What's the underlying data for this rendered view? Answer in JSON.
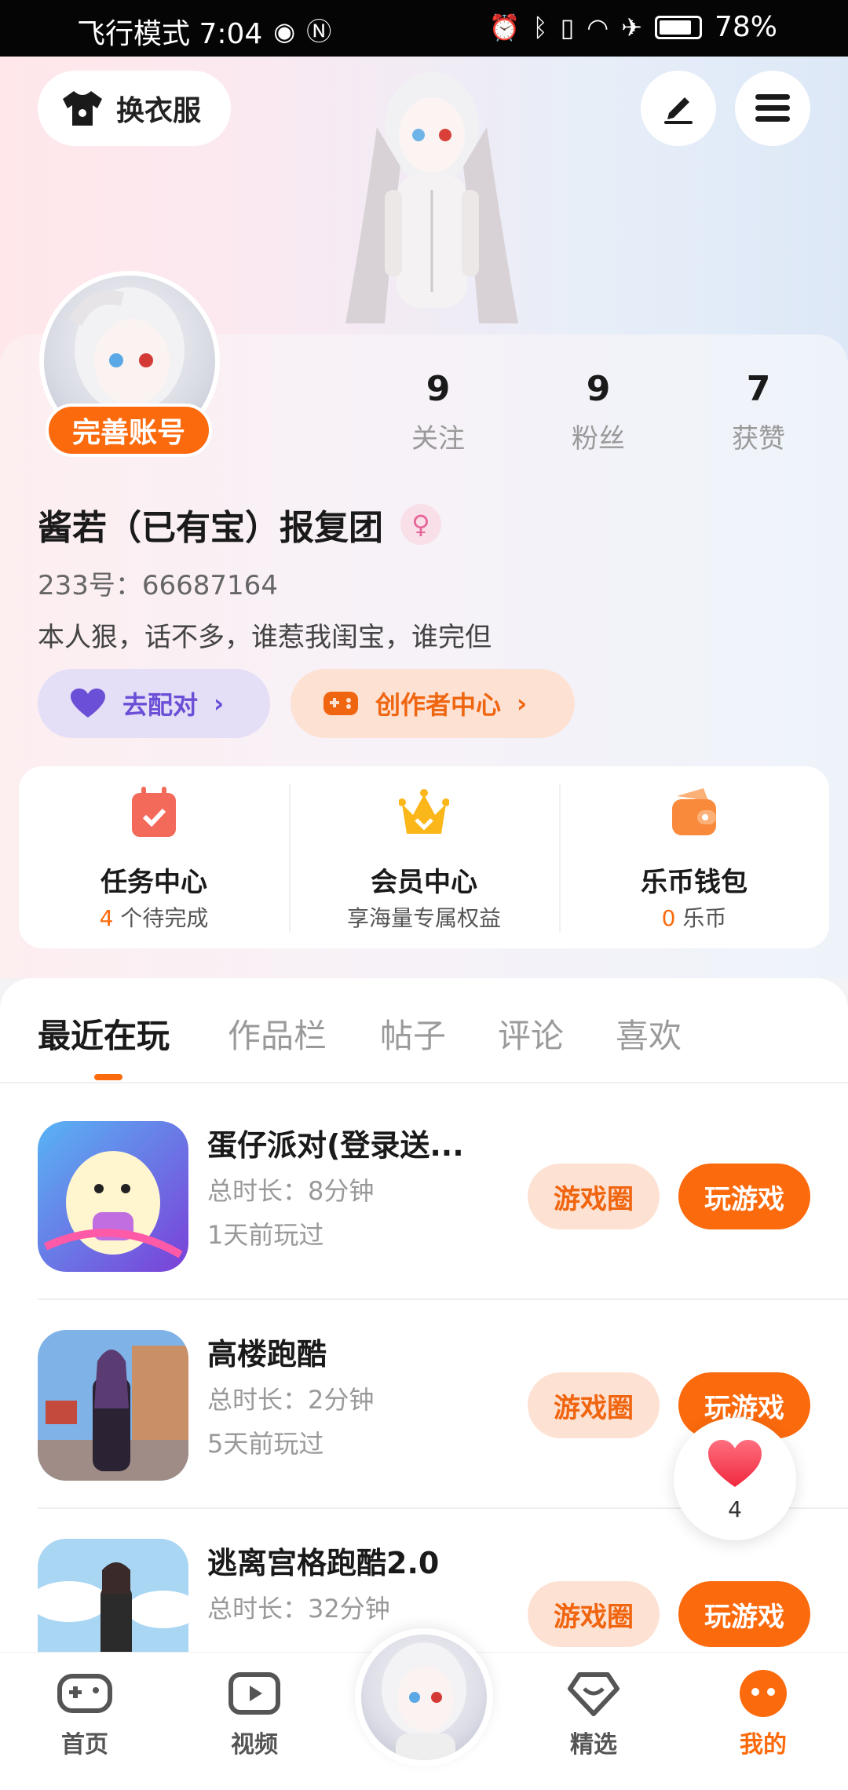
{
  "status_bar": {
    "left_text": "飞行模式 7:04",
    "battery_percent": "78%"
  },
  "header": {
    "outfit_label": "换衣服",
    "icons": [
      "shirt-icon",
      "edit-icon",
      "menu-icon"
    ]
  },
  "profile": {
    "complete_label": "完善账号",
    "stats": [
      {
        "value": "9",
        "label": "关注"
      },
      {
        "value": "9",
        "label": "粉丝"
      },
      {
        "value": "7",
        "label": "获赞"
      }
    ],
    "username": "酱若（已有宝）报复团",
    "gender": "female",
    "uid": "233号：66687164",
    "bio": "本人狠，话不多，谁惹我闺宝，谁完但",
    "match_label": "去配对",
    "creator_label": "创作者中心"
  },
  "quick": [
    {
      "title": "任务中心",
      "sub_highlight": "4",
      "sub_text": " 个待完成",
      "icon": "task-calendar-icon"
    },
    {
      "title": "会员中心",
      "sub_highlight": "",
      "sub_text": "享海量专属权益",
      "icon": "crown-icon"
    },
    {
      "title": "乐币钱包",
      "sub_highlight": "0",
      "sub_text": " 乐币",
      "icon": "wallet-icon"
    }
  ],
  "tabs": [
    {
      "label": "最近在玩",
      "active": true
    },
    {
      "label": "作品栏",
      "active": false
    },
    {
      "label": "帖子",
      "active": false
    },
    {
      "label": "评论",
      "active": false
    },
    {
      "label": "喜欢",
      "active": false
    }
  ],
  "games": [
    {
      "title": "蛋仔派对(登录送...",
      "duration": "总时长：8分钟",
      "last_played": "1天前玩过"
    },
    {
      "title": "高楼跑酷",
      "duration": "总时长：2分钟",
      "last_played": "5天前玩过"
    },
    {
      "title": "逃离宫格跑酷2.0",
      "duration": "总时长：32分钟",
      "last_played": ""
    }
  ],
  "game_actions": {
    "circle_label": "游戏圈",
    "play_label": "玩游戏"
  },
  "float_like_count": "4",
  "nav": [
    {
      "label": "首页",
      "icon": "gamepad-icon",
      "active": false
    },
    {
      "label": "视频",
      "icon": "video-icon",
      "active": false
    },
    {
      "label": "精选",
      "icon": "heart-diamond-icon",
      "active": false
    },
    {
      "label": "我的",
      "icon": "me-face-icon",
      "active": true
    }
  ],
  "colors": {
    "accent": "#fb6a0d",
    "match_purple": "#6b4fd6",
    "accent_soft": "#fde2d4"
  }
}
